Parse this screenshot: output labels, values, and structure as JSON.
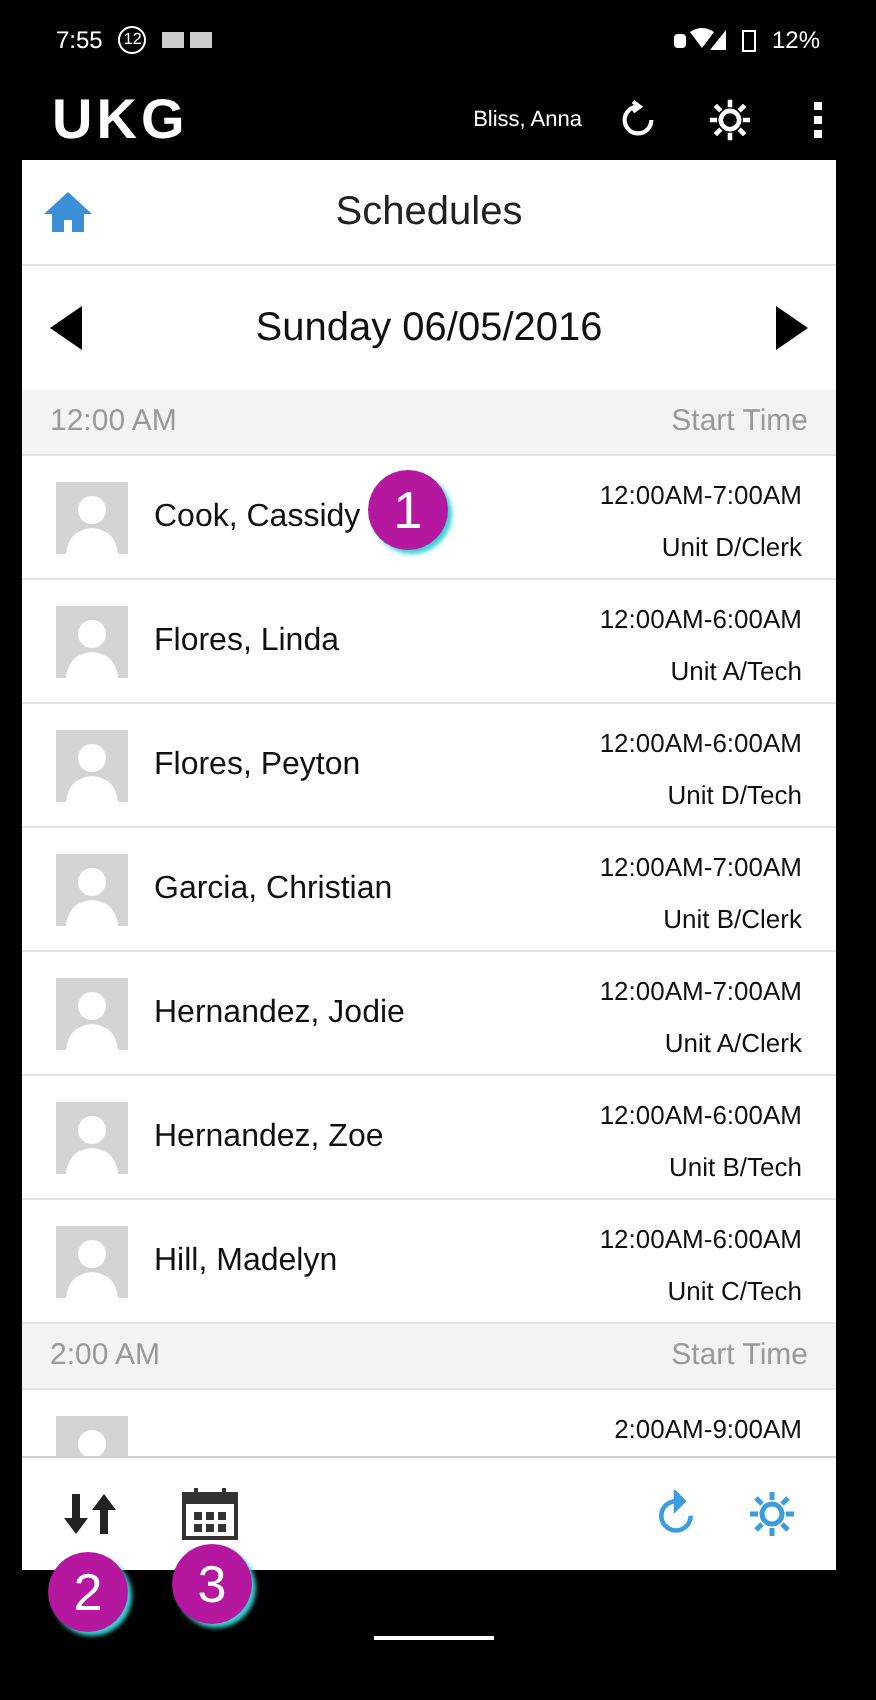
{
  "status_bar": {
    "time": "7:55",
    "notification_count": "12",
    "battery": "12%"
  },
  "app_bar": {
    "logo": "UKG",
    "user": "Bliss, Anna"
  },
  "title": "Schedules",
  "date": "Sunday 06/05/2016",
  "groups": [
    {
      "time": "12:00 AM",
      "column": "Start Time",
      "rows": [
        {
          "name": "Cook, Cassidy",
          "shift": "12:00AM-7:00AM",
          "unit": "Unit D/Clerk",
          "callout": "1"
        },
        {
          "name": "Flores, Linda",
          "shift": "12:00AM-6:00AM",
          "unit": "Unit A/Tech"
        },
        {
          "name": "Flores, Peyton",
          "shift": "12:00AM-6:00AM",
          "unit": "Unit D/Tech"
        },
        {
          "name": "Garcia, Christian",
          "shift": "12:00AM-7:00AM",
          "unit": "Unit B/Clerk"
        },
        {
          "name": "Hernandez, Jodie",
          "shift": "12:00AM-7:00AM",
          "unit": "Unit A/Clerk"
        },
        {
          "name": "Hernandez, Zoe",
          "shift": "12:00AM-6:00AM",
          "unit": "Unit B/Tech"
        },
        {
          "name": "Hill, Madelyn",
          "shift": "12:00AM-6:00AM",
          "unit": "Unit C/Tech"
        }
      ]
    },
    {
      "time": "2:00 AM",
      "column": "Start Time",
      "rows": [
        {
          "shift": "2:00AM-9:00AM"
        }
      ]
    }
  ],
  "footer_callouts": {
    "sort": "2",
    "calendar": "3"
  }
}
